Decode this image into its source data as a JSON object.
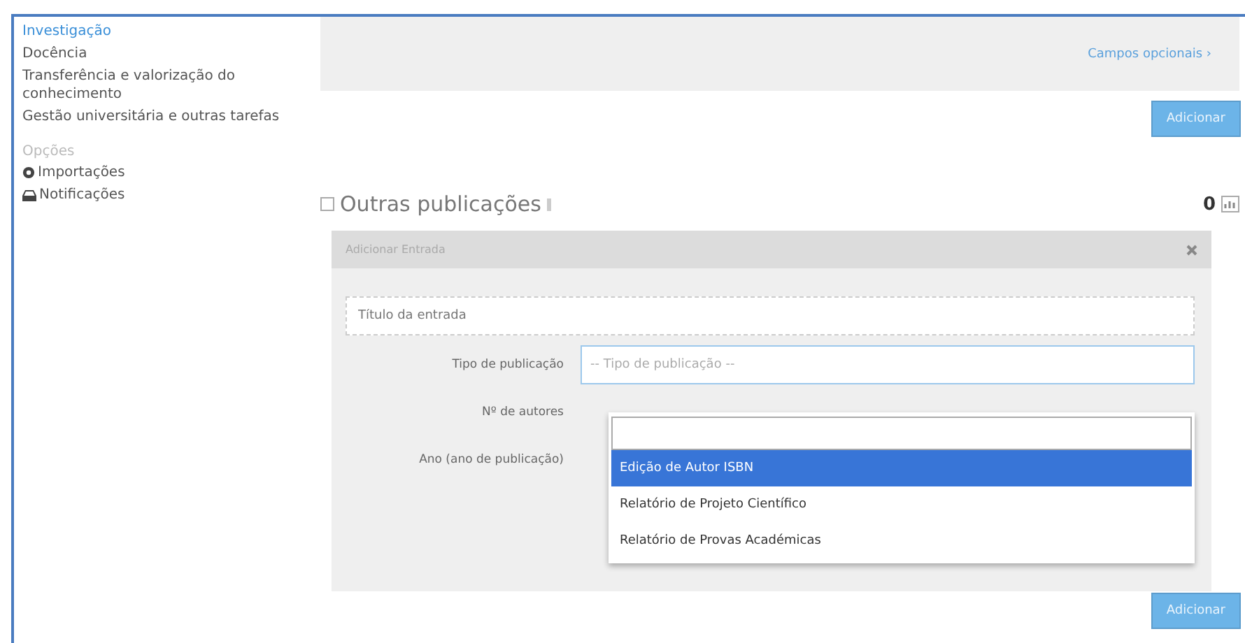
{
  "sidebar": {
    "items": [
      {
        "label": "Investigação",
        "selected": true
      },
      {
        "label": "Docência",
        "selected": false
      },
      {
        "label": "Transferência e valorização do conhecimento",
        "selected": false
      },
      {
        "label": "Gestão universitária e outras tarefas",
        "selected": false
      }
    ],
    "options_heading": "Opções",
    "options": [
      {
        "label": "Importações",
        "kind": "import"
      },
      {
        "label": "Notificações",
        "kind": "notify"
      }
    ]
  },
  "top_panel": {
    "link": "Campos opcionais ›",
    "button": "Adicionar"
  },
  "section": {
    "title": "Outras publicações",
    "checked": false,
    "count": "0"
  },
  "entry_panel": {
    "header": "Adicionar Entrada",
    "title_placeholder": "Título da entrada",
    "type_label": "Tipo de publicação",
    "type_placeholder": "-- Tipo de publicação --",
    "authors_label": "Nº de autores",
    "year_label": "Ano (ano de publicação)",
    "dropdown": {
      "options": [
        {
          "label": "Edição de Autor ISBN",
          "selected": true
        },
        {
          "label": "Relatório de Projeto Científico",
          "selected": false
        },
        {
          "label": "Relatório de Provas Académicas",
          "selected": false
        }
      ]
    }
  },
  "bottom_button": "Adicionar"
}
